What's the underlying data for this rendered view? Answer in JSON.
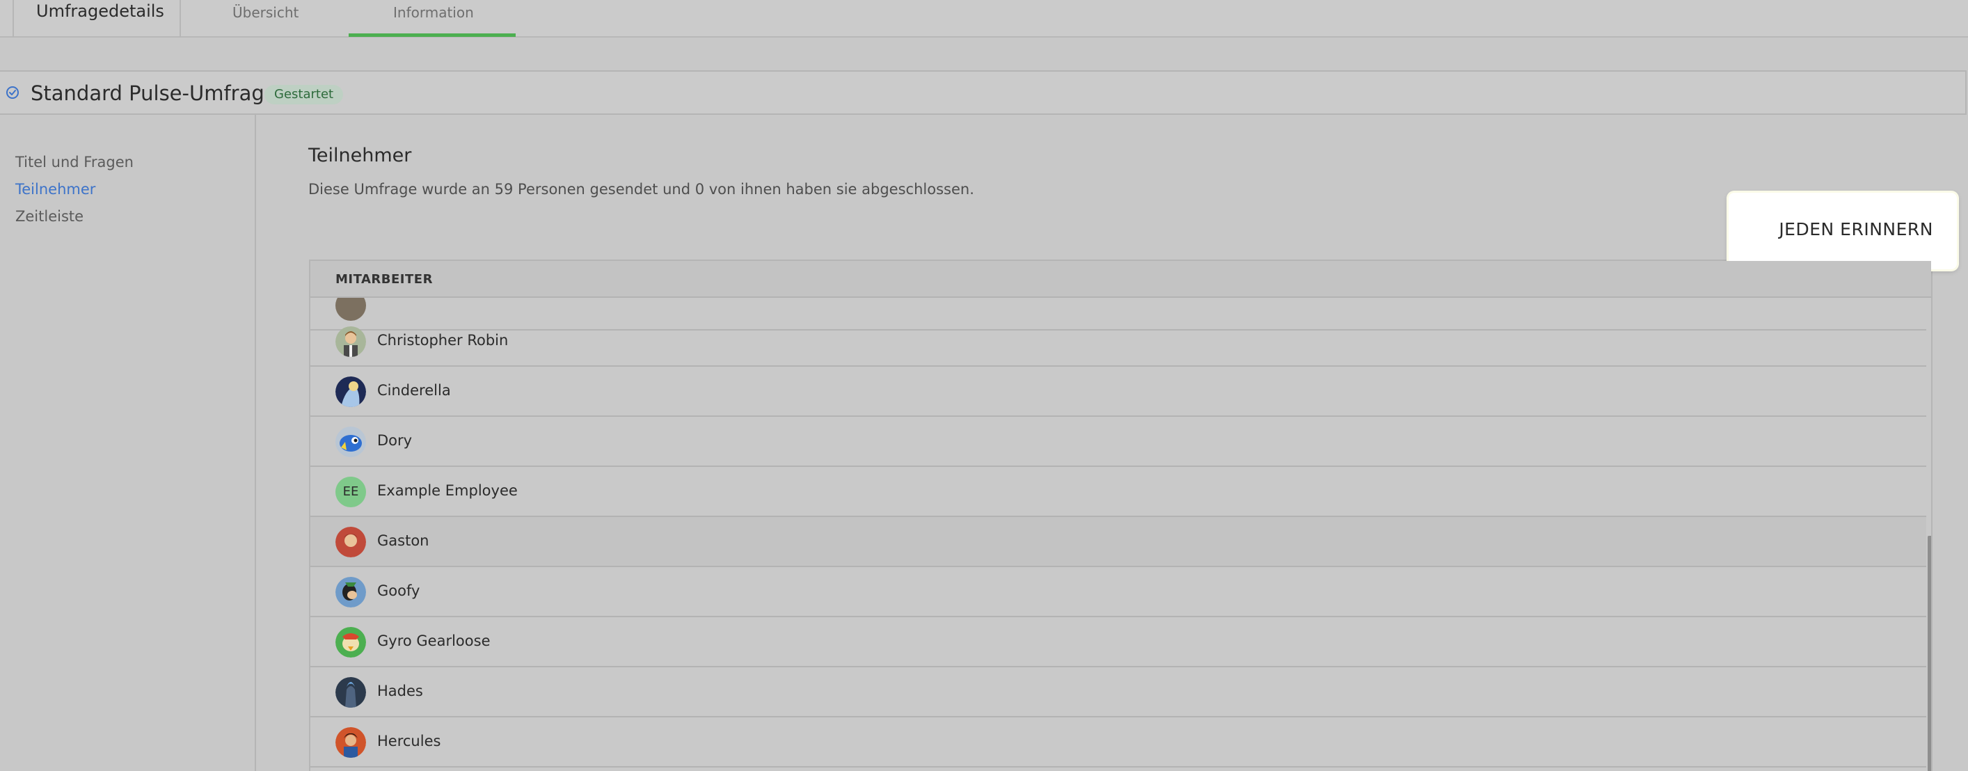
{
  "header": {
    "title": "Umfragedetails",
    "tabs": [
      {
        "label": "Übersicht",
        "active": false
      },
      {
        "label": "Information",
        "active": true
      }
    ]
  },
  "survey": {
    "title": "Standard Pulse-Umfrage",
    "status": "Gestartet"
  },
  "sidebar": {
    "items": [
      {
        "label": "Titel und Fragen",
        "active": false
      },
      {
        "label": "Teilnehmer",
        "active": true
      },
      {
        "label": "Zeitleiste",
        "active": false
      }
    ]
  },
  "participants": {
    "title": "Teilnehmer",
    "description": "Diese Umfrage wurde an 59 Personen gesendet und 0 von ihnen haben sie abgeschlossen.",
    "remind_button": "JEDEN ERINNERN",
    "table": {
      "column": "MITARBEITER",
      "rows": [
        {
          "name": "Christopher Robin"
        },
        {
          "name": "Cinderella"
        },
        {
          "name": "Dory"
        },
        {
          "name": "Example Employee",
          "initials": "EE"
        },
        {
          "name": "Gaston"
        },
        {
          "name": "Goofy"
        },
        {
          "name": "Gyro Gearloose"
        },
        {
          "name": "Hades"
        },
        {
          "name": "Hercules"
        }
      ]
    }
  },
  "colors": {
    "accent_green": "#4caf50",
    "link_blue": "#3d73c9",
    "badge_bg": "#bed0c3"
  }
}
